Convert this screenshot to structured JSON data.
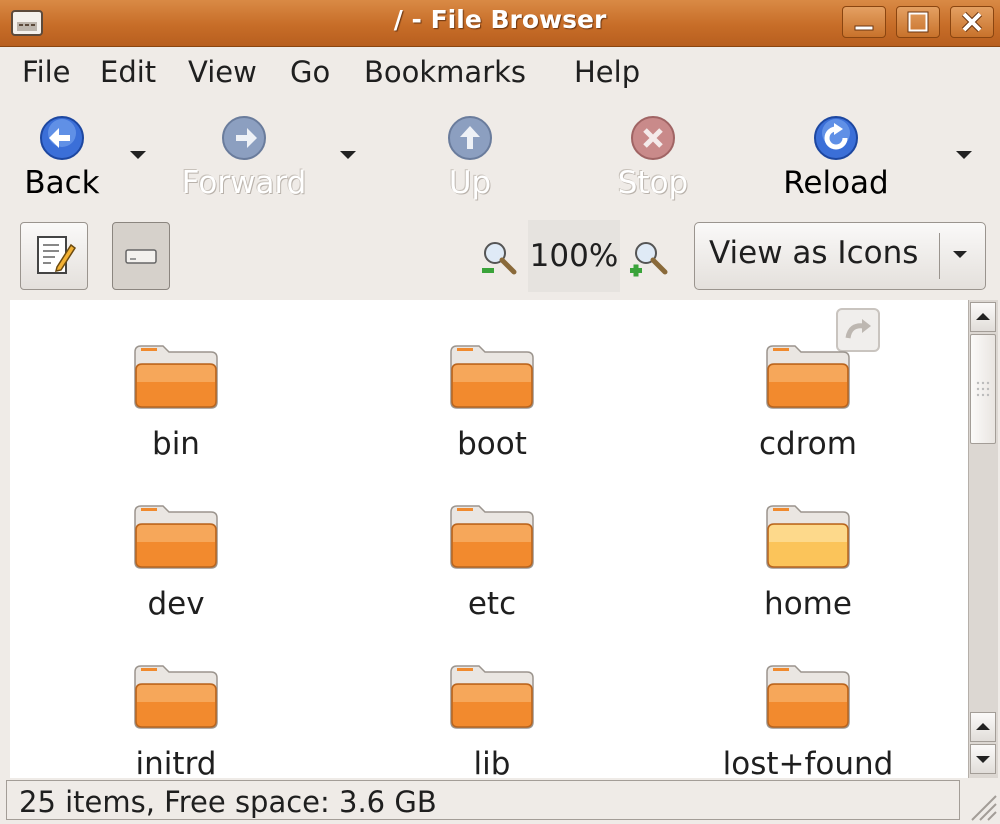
{
  "window": {
    "title": "/ - File Browser"
  },
  "menu": [
    "File",
    "Edit",
    "View",
    "Go",
    "Bookmarks",
    "Help"
  ],
  "toolbar": {
    "back": "Back",
    "forward": "Forward",
    "up": "Up",
    "stop": "Stop",
    "reload": "Reload"
  },
  "location": {
    "zoom": "100%",
    "view_mode": "View as Icons"
  },
  "files": [
    {
      "name": "bin"
    },
    {
      "name": "boot"
    },
    {
      "name": "cdrom"
    },
    {
      "name": "dev"
    },
    {
      "name": "etc"
    },
    {
      "name": "home"
    },
    {
      "name": "initrd"
    },
    {
      "name": "lib"
    },
    {
      "name": "lost+found"
    }
  ],
  "status": {
    "text": "25 items, Free space: 3.6 GB"
  },
  "colors": {
    "title_bar": "#c76d28",
    "folder": "#f28a2e",
    "home_folder": "#fbc45a"
  }
}
